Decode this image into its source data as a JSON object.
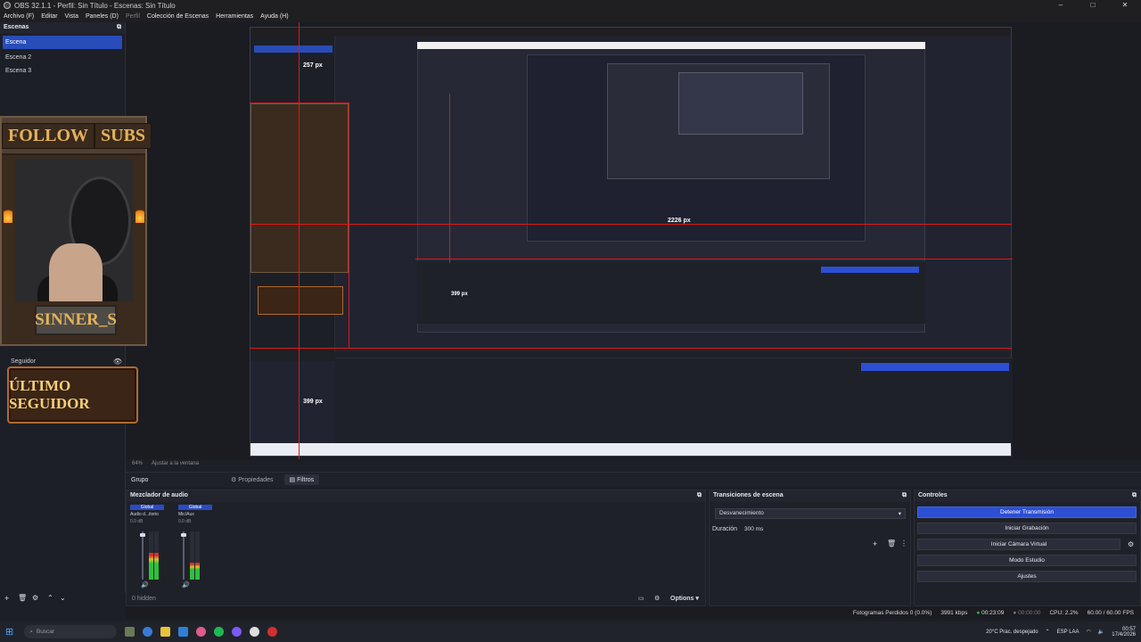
{
  "window": {
    "title": "OBS 32.1.1 - Perfil: Sin Título - Escenas: Sin Título",
    "minimize": "–",
    "maximize": "□",
    "close": "✕"
  },
  "menu": {
    "items": [
      "Archivo (F)",
      "Editar",
      "Vista",
      "Paneles (D)",
      "Perfil",
      "Colección de Escenas",
      "Herramientas",
      "Ayuda (H)"
    ]
  },
  "scenes": {
    "title": "Escenas",
    "items": [
      "Escena",
      "Escena 2",
      "Escena 3"
    ]
  },
  "overlay": {
    "follow": "FOLLOW",
    "subs": "SUBS",
    "name": "SINNER_S",
    "follower_badge": "ÚLTIMO SEGUIDOR",
    "source_name": "Seguidor"
  },
  "preview_labels": {
    "px1": "257 px",
    "px2": "399 px",
    "px3": "2226 px",
    "px4": "399 px"
  },
  "preview_bottom": {
    "zoom": "64%",
    "fit": "Ajustar a la ventana"
  },
  "sources": {
    "group": "Grupo",
    "properties_tab": "Propiedades",
    "filters_tab": "Filtros"
  },
  "mixer": {
    "title": "Mezclador de audio",
    "channels": [
      {
        "hdr": "Global",
        "name": "Audio d...itorio",
        "db": "0.0 dB",
        "level": 0.55
      },
      {
        "hdr": "Global",
        "name": "Mic/Aux",
        "db": "0.0 dB",
        "level": 0.35
      }
    ],
    "hidden": "0 hidden",
    "options": "Options"
  },
  "transitions": {
    "title": "Transiciones de escena",
    "selected": "Desvanecimiento",
    "duration_label": "Duración",
    "duration_value": "300 ms"
  },
  "controls": {
    "title": "Controles",
    "buttons": [
      "Detener Transmisión",
      "Iniciar Grabación",
      "Iniciar Cámara Virtual",
      "Modo Estudio",
      "Ajustes"
    ]
  },
  "status": {
    "dropped": "Fotogramas Perdidos 0 (0.0%)",
    "bitrate": "3991 kbps",
    "stream_time": "00:23:09",
    "rec_time": "00:00:00",
    "cpu": "CPU: 2.2%",
    "fps": "60.00 / 60.00 FPS"
  },
  "taskbar": {
    "search": "Buscar",
    "weather_temp": "20°C",
    "weather_desc": "Prac. despejado",
    "lang": "ESP",
    "lang2": "LAA",
    "time": "00:57",
    "date": "17/4/2026"
  },
  "colors": {
    "accent": "#2d4fd4",
    "guide": "#e01818"
  }
}
